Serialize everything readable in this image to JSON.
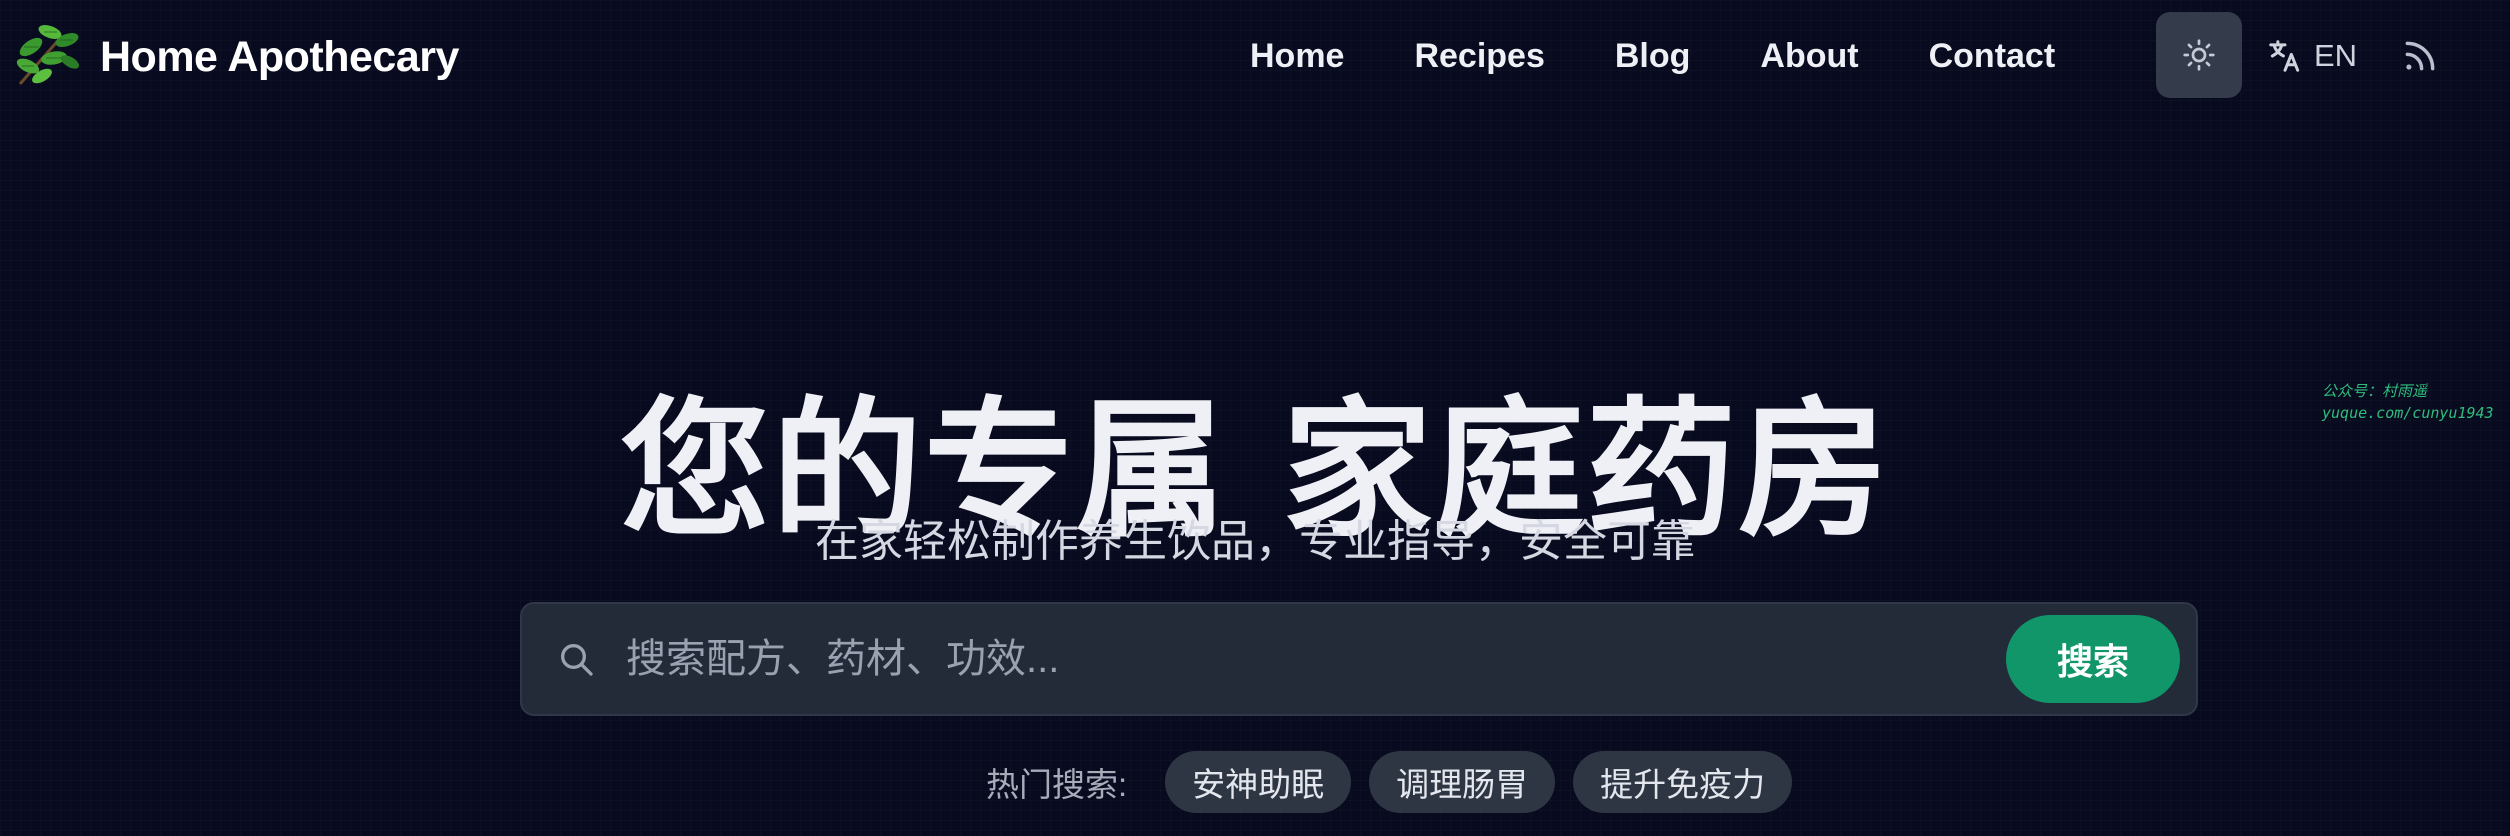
{
  "brand": {
    "name": "Home Apothecary",
    "logo_icon": "herb-leaves-icon"
  },
  "nav": {
    "links": [
      "Home",
      "Recipes",
      "Blog",
      "About",
      "Contact"
    ],
    "theme_toggle_icon": "sun-icon",
    "language_icon": "translate-icon",
    "language_label": "EN",
    "rss_icon": "rss-icon"
  },
  "hero": {
    "title": "您的专属 家庭药房",
    "subtitle": "在家轻松制作养生饮品，专业指导，安全可靠"
  },
  "search": {
    "placeholder": "搜索配方、药材、功效...",
    "value": "",
    "button_label": "搜索"
  },
  "hot_search": {
    "label": "热门搜索:",
    "tags": [
      "安神助眠",
      "调理肠胃",
      "提升免疫力"
    ]
  },
  "watermark": {
    "line1": "公众号：村雨遥",
    "line2": "yuque.com/cunyu1943"
  },
  "colors": {
    "background": "#080a1f",
    "accent": "#109668",
    "search_bg": "#232a38",
    "tag_bg": "#2f3643",
    "watermark": "#2fbd7d"
  }
}
